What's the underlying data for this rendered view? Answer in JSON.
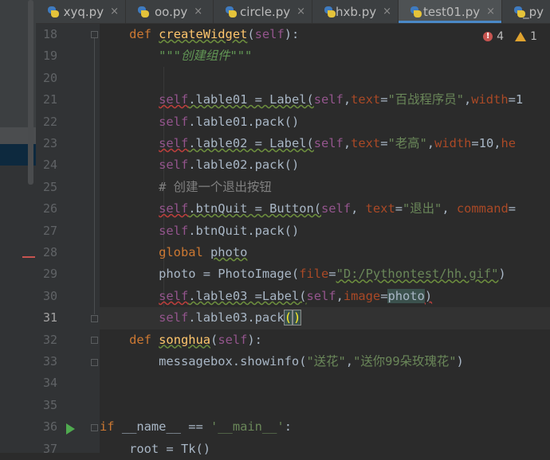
{
  "tabs": [
    {
      "label": "xyq.py",
      "close": "×"
    },
    {
      "label": "oo.py",
      "close": "×"
    },
    {
      "label": "circle.py",
      "close": "×"
    },
    {
      "label": "hxb.py",
      "close": "×"
    },
    {
      "label": "test01.py",
      "close": "×",
      "active": true
    },
    {
      "label": "_py",
      "close": ""
    }
  ],
  "inspections": {
    "errors": "4",
    "warnings": "1"
  },
  "lines": [
    "18",
    "19",
    "20",
    "21",
    "22",
    "23",
    "24",
    "25",
    "26",
    "27",
    "28",
    "29",
    "30",
    "31",
    "32",
    "33",
    "34",
    "35",
    "36",
    "37"
  ],
  "code": {
    "l18": {
      "kw": "def ",
      "fn": "createWidget",
      "p1": "(",
      "self": "self",
      "p2": "):"
    },
    "l19": {
      "doc": "\"\"\"创建组件\"\"\""
    },
    "l21": {
      "self": "self",
      "a": ".lable01 = Label(",
      "self2": "self",
      "c": ",",
      "par": "text",
      "eq": "=",
      "str": "\"百战程序员\"",
      "c2": ",",
      "par2": "width",
      "rest": "=1"
    },
    "l22": {
      "self": "self",
      "a": ".lable01.pack()"
    },
    "l23": {
      "self": "self",
      "a": ".lable02 = Label(",
      "self2": "self",
      "c": ",",
      "par": "text",
      "eq": "=",
      "str": "\"老高\"",
      "c2": ",",
      "par2": "width",
      "eq2": "=10,",
      "par3": "he"
    },
    "l24": {
      "self": "self",
      "a": ".lable02.pack()"
    },
    "l25": {
      "cmt": "# 创建一个退出按钮"
    },
    "l26": {
      "self": "self",
      "a": ".btnQuit = Button(",
      "self2": "self",
      "c": ", ",
      "par": "text",
      "eq": "=",
      "str": "\"退出\"",
      "c2": ", ",
      "par2": "command",
      "rest": "="
    },
    "l27": {
      "self": "self",
      "a": ".btnQuit.pack()"
    },
    "l28": {
      "kw": "global ",
      "name": "photo"
    },
    "l29": {
      "a": "photo = PhotoImage(",
      "par": "file",
      "eq": "=",
      "str": "\"D:/Pythontest/hh.gif\"",
      "close": ")"
    },
    "l30": {
      "self": "self",
      "a": ".lable03 =Label(",
      "self2": "self",
      "c": ",",
      "par": "image",
      "eq": "=",
      "name": "photo",
      "close": ")"
    },
    "l31": {
      "self": "self",
      "a": ".lable03.pack",
      "b1": "(",
      "b2": ")"
    },
    "l32": {
      "kw": "def ",
      "fn": "songhua",
      "p1": "(",
      "self": "self",
      "p2": "):"
    },
    "l33": {
      "a": "messagebox.showinfo(",
      "str1": "\"送花\"",
      "c": ",",
      "str2": "\"送你99朵玫瑰花\"",
      "close": ")"
    },
    "l36": {
      "kw": "if ",
      "a": "__name__ == ",
      "str": "'__main__'",
      "colon": ":"
    },
    "l37": {
      "a": "root = Tk()"
    }
  },
  "colors": {
    "keyword": "#cc7832",
    "function": "#ffc66d",
    "self": "#94558d",
    "string": "#6a8759",
    "param": "#aa4926",
    "comment": "#808080"
  }
}
